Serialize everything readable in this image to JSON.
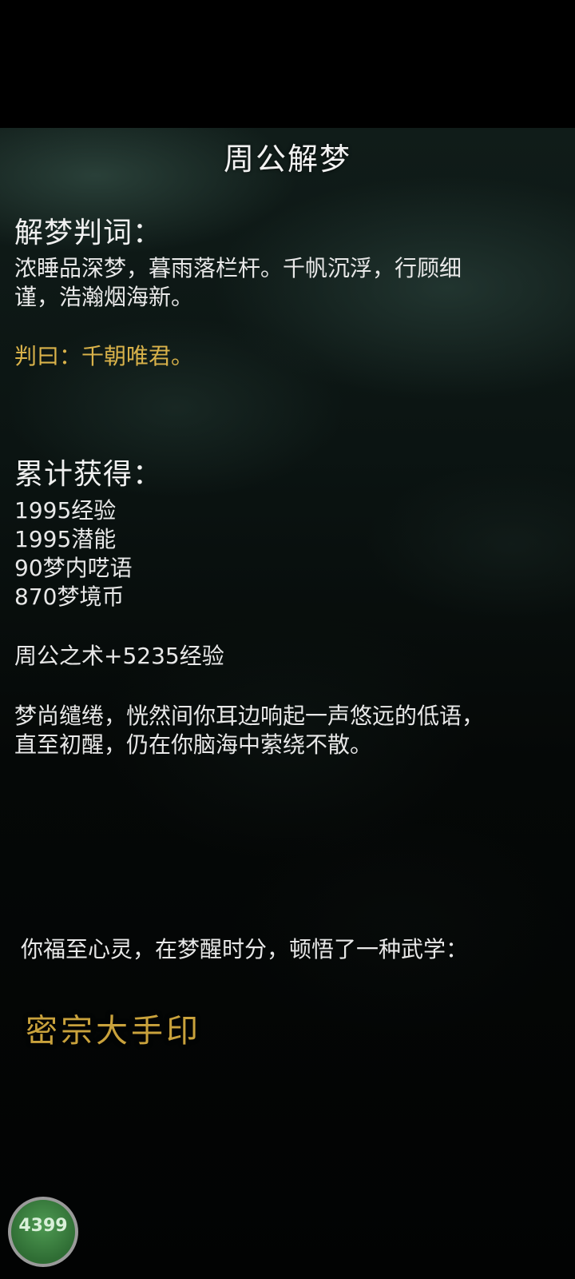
{
  "title": "周公解梦",
  "judgement": {
    "heading": "解梦判词：",
    "poem_line1": "浓睡品深梦，暮雨落栏杆。千帆沉浮，行顾细",
    "poem_line2": "谨，浩瀚烟海新。",
    "verdict": "判曰：千朝唯君。"
  },
  "rewards": {
    "heading": "累计获得：",
    "items": [
      "1995经验",
      "1995潜能",
      "90梦内呓语",
      "870梦境币"
    ],
    "bonus": "周公之术+5235经验"
  },
  "epilogue": {
    "line1": "梦尚缱绻，恍然间你耳边响起一声悠远的低语，",
    "line2": "直至初醒，仍在你脑海中萦绕不散。"
  },
  "enlightenment": {
    "text": "你福至心灵，在梦醒时分，顿悟了一种武学：",
    "skill": "密宗大手印"
  },
  "badge": {
    "text": "4399"
  },
  "colors": {
    "background": "#000000",
    "text": "#e8e8e8",
    "gold": "#d9b24a",
    "skill": "#c9a23c",
    "badge": "#3f8a44"
  }
}
